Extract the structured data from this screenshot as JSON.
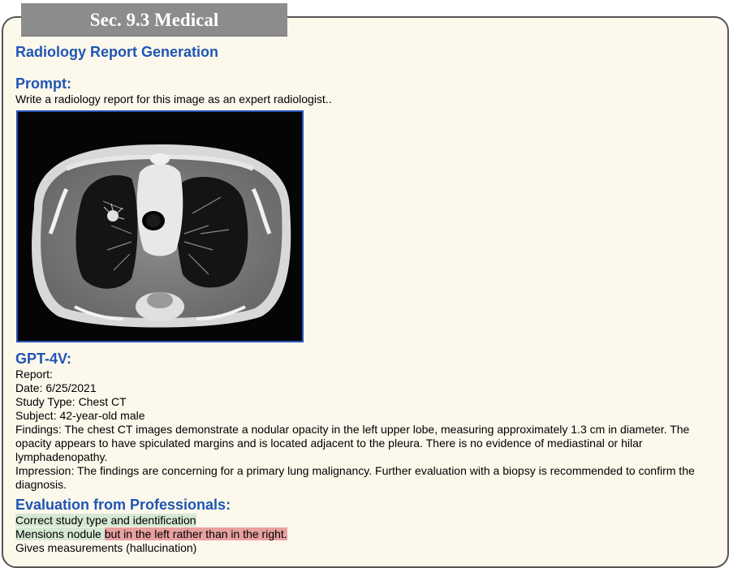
{
  "header": {
    "tab_label": "Sec. 9.3 Medical"
  },
  "main": {
    "title": "Radiology Report Generation",
    "prompt_heading": "Prompt:",
    "prompt_text": "Write a radiology report for this image as an expert radiologist..",
    "image_label": "chest-ct-axial-slice",
    "response_heading": "GPT-4V:",
    "report_lines": [
      "Report:",
      "Date: 6/25/2021",
      "Study Type: Chest CT",
      "Subject: 42-year-old male",
      "Findings: The chest CT images demonstrate a nodular opacity in the left upper lobe, measuring approximately 1.3 cm in diameter. The opacity appears to have spiculated margins and is located adjacent to the pleura. There is no evidence of mediastinal or hilar lymphadenopathy.",
      "Impression: The findings are concerning for a primary lung malignancy. Further evaluation with a biopsy is recommended to confirm the diagnosis."
    ],
    "eval_heading": "Evaluation from Professionals:",
    "eval": {
      "line1": "Correct study type and identification",
      "line2_plain": "Mensions nodule ",
      "line2_red": "but in the left rather than in the right.",
      "line3": "Gives measurements (hallucination)"
    }
  },
  "colors": {
    "heading": "#1f55b5",
    "highlight_green": "#d5e8d4",
    "highlight_red": "#e8a0a0",
    "tab_bg": "#8c8c8c"
  }
}
